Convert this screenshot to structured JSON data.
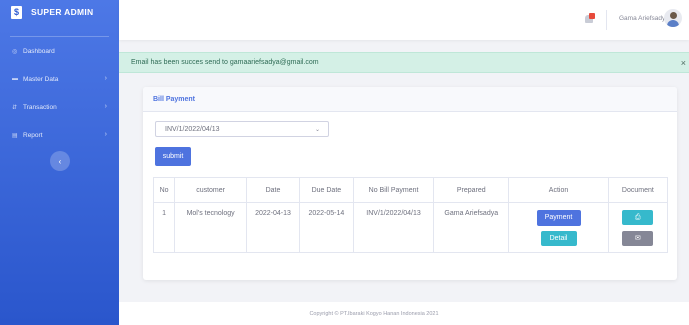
{
  "sidebar": {
    "brand": "SUPER ADMIN",
    "brand_logo": "$",
    "items": [
      {
        "label": "Dashboard",
        "icon": "dashboard-icon"
      },
      {
        "label": "Master Data",
        "icon": "folder-icon"
      },
      {
        "label": "Transaction",
        "icon": "transaction-icon"
      },
      {
        "label": "Report",
        "icon": "report-icon"
      }
    ],
    "toggle_icon": "‹"
  },
  "topbar": {
    "user_name": "Gama Ariefsadya"
  },
  "alert": {
    "message": "Email has been succes send to gamaariefsadya@gmail.com",
    "close": "×"
  },
  "card": {
    "title": "Bill Payment",
    "select_value": "INV/1/2022/04/13",
    "submit_label": "submit"
  },
  "table": {
    "headers": [
      "No",
      "customer",
      "Date",
      "Due Date",
      "No Bill Payment",
      "Prepared",
      "Action",
      "Document"
    ],
    "rows": [
      {
        "no": "1",
        "customer": "Mol's tecnology",
        "date": "2022-04-13",
        "due_date": "2022-05-14",
        "no_bill": "INV/1/2022/04/13",
        "prepared": "Gama Ariefsadya",
        "action_primary": "Payment",
        "action_secondary": "Detail",
        "doc_print_icon": "printer-icon",
        "doc_mail_icon": "envelope-icon"
      }
    ]
  },
  "footer": {
    "copyright": "Copyright © PT.Ibaraki Kogyo Hanan Indonesia 2021"
  },
  "colors": {
    "primary": "#4e73df",
    "info": "#36b9cc",
    "secondary": "#858796",
    "success_bg": "#d4f0e6"
  }
}
